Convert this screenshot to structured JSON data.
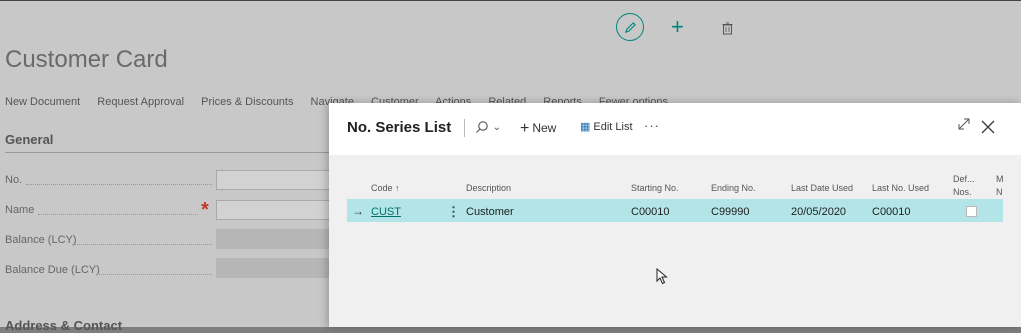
{
  "page": {
    "title": "Customer Card",
    "action_bar": [
      "New Document",
      "Request Approval",
      "Prices & Discounts",
      "Navigate",
      "Customer",
      "Actions",
      "Related",
      "Reports",
      "Fewer options"
    ],
    "general_tab": "General",
    "fields": [
      {
        "label": "No.",
        "required": false
      },
      {
        "label": "Name",
        "required": true
      },
      {
        "label": "Balance (LCY)",
        "required": false
      },
      {
        "label": "Balance Due (LCY)",
        "required": false
      }
    ],
    "address_tab": "Address & Contact"
  },
  "dialog": {
    "title": "No. Series List",
    "new_label": "New",
    "edit_list_label": "Edit List",
    "more_label": "···",
    "columns": {
      "code": "Code ↑",
      "description": "Description",
      "starting_no": "Starting No.",
      "ending_no": "Ending No.",
      "last_date_used": "Last Date Used",
      "last_no_used": "Last No. Used",
      "default_nos_1": "Def...",
      "default_nos_2": "Nos.",
      "manual_nos_1": "M",
      "manual_nos_2": "N"
    },
    "rows": [
      {
        "code": "CUST",
        "description": "Customer",
        "starting_no": "C00010",
        "ending_no": "C99990",
        "last_date_used": "20/05/2020",
        "last_no_used": "C00010",
        "default_nos": false
      }
    ]
  },
  "icons": {
    "edit": "pencil-icon",
    "add": "plus-icon",
    "delete": "trash-icon",
    "search": "search-icon",
    "expand": "expand-icon",
    "close": "close-icon"
  },
  "colors": {
    "accent": "#00857c",
    "selected_row": "#b3e5e8",
    "required": "#c0392b"
  }
}
